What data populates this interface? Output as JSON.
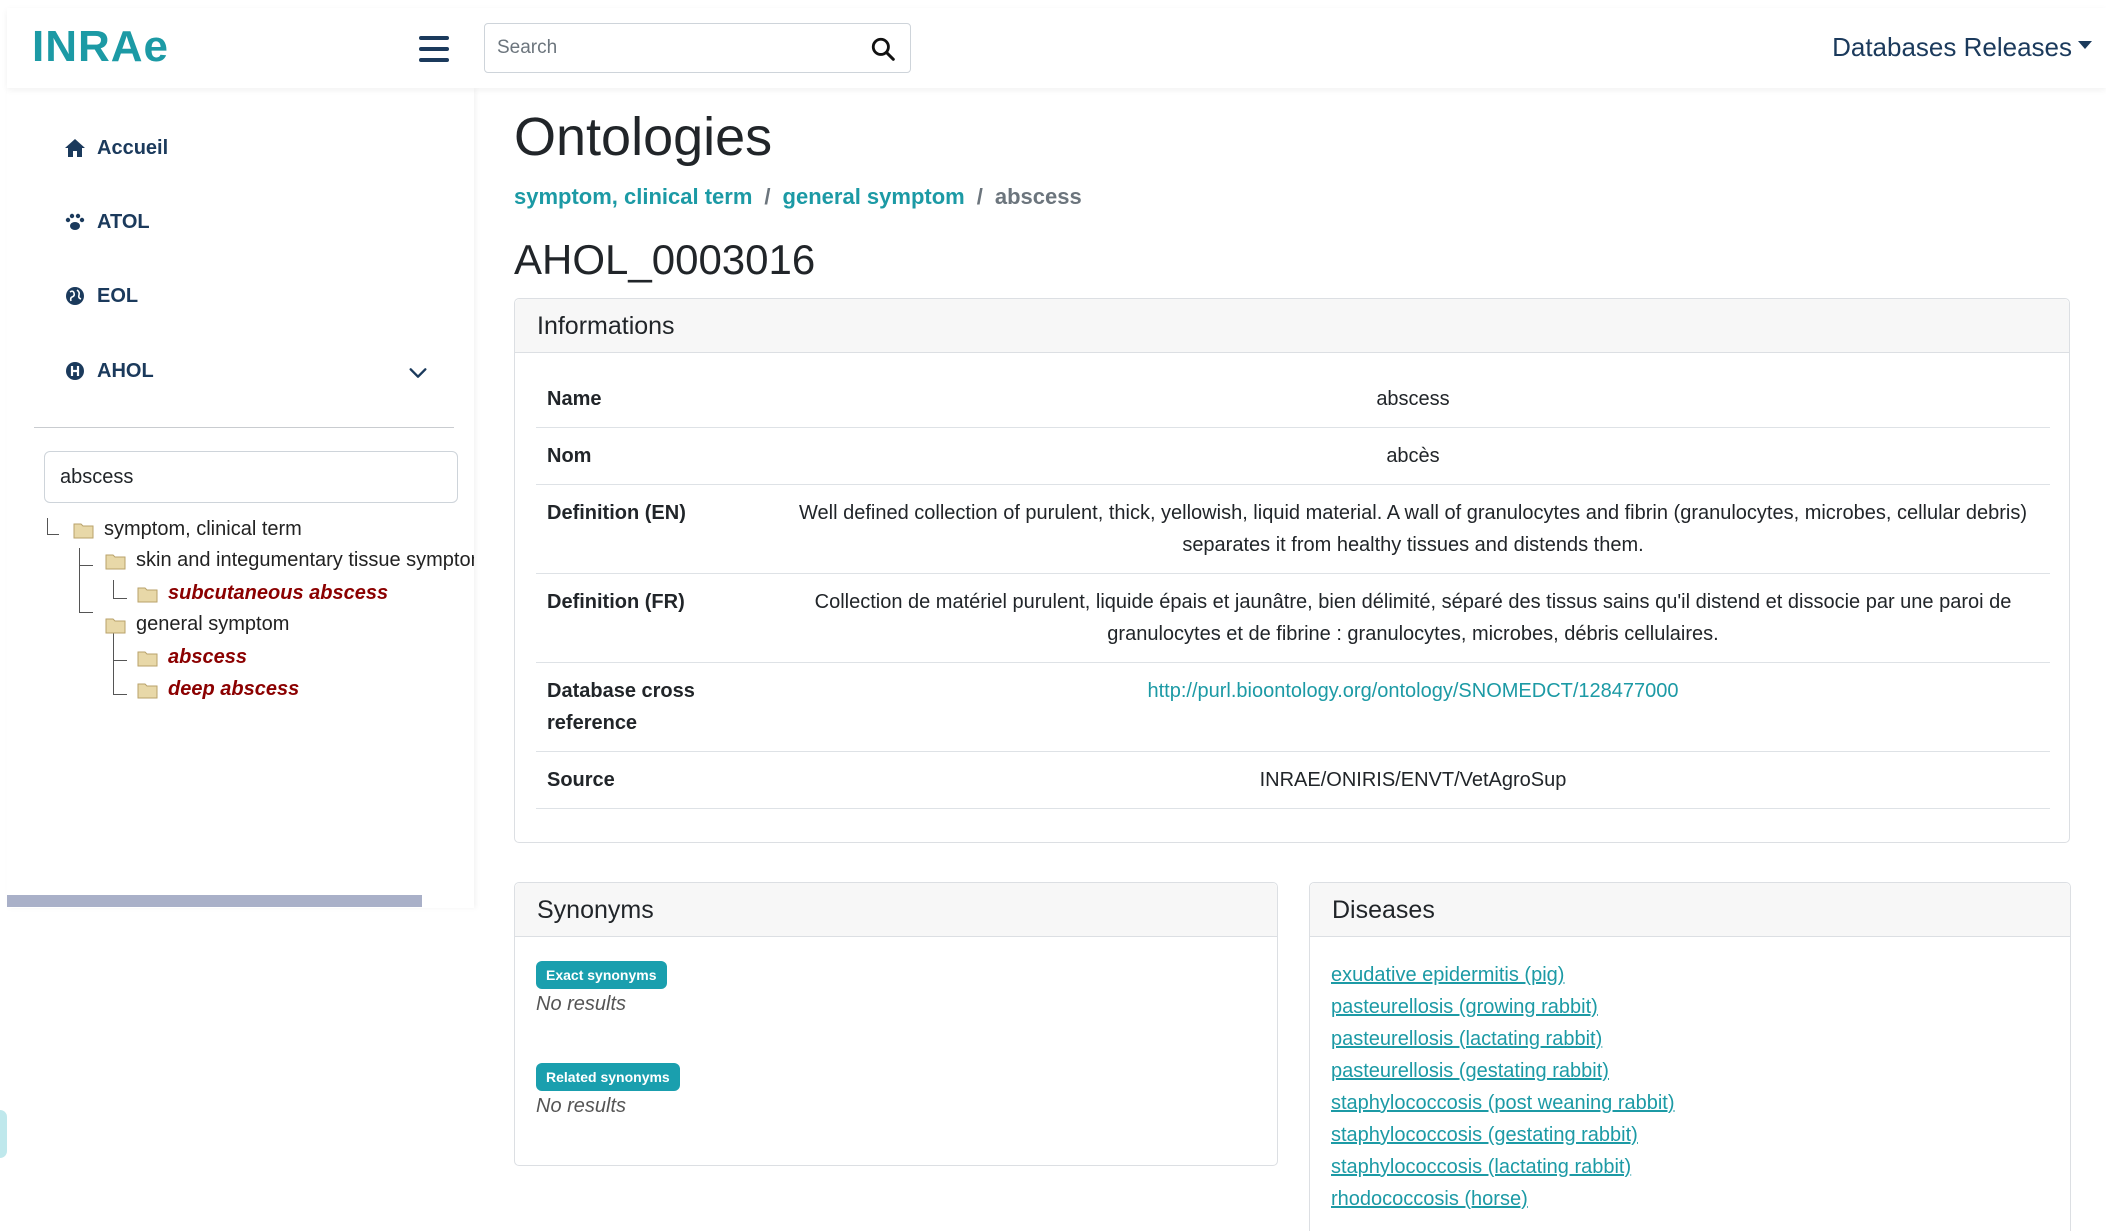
{
  "header": {
    "logo_text": "INRAe",
    "search_placeholder": "Search",
    "databases_releases_label": "Databases Releases"
  },
  "sidebar": {
    "nav": [
      {
        "label": "Accueil",
        "icon": "home-icon"
      },
      {
        "label": "ATOL",
        "icon": "paw-icon"
      },
      {
        "label": "EOL",
        "icon": "globe-icon"
      },
      {
        "label": "AHOL",
        "icon": "h-circle-icon"
      }
    ],
    "tree_search_value": "abscess",
    "tree": [
      {
        "label": "symptom, clinical term",
        "match": false
      },
      {
        "label": "skin and integumentary tissue symptom",
        "match": false
      },
      {
        "label": "subcutaneous abscess",
        "match": true
      },
      {
        "label": "general symptom",
        "match": false
      },
      {
        "label": "abscess",
        "match": true
      },
      {
        "label": "deep abscess",
        "match": true
      }
    ]
  },
  "main": {
    "title": "Ontologies",
    "breadcrumb": [
      {
        "label": "symptom, clinical term"
      },
      {
        "label": "general symptom"
      },
      {
        "label": "abscess"
      }
    ],
    "breadcrumb_separator": "/",
    "term_id": "AHOL_0003016",
    "informations": {
      "header": "Informations",
      "rows": [
        {
          "key": "Name",
          "value": "abscess"
        },
        {
          "key": "Nom",
          "value": "abcès"
        },
        {
          "key": "Definition (EN)",
          "value": "Well defined collection of purulent, thick, yellowish, liquid material. A wall of granulocytes and fibrin (granulocytes, microbes, cellular debris) separates it from healthy tissues and distends them."
        },
        {
          "key": "Definition (FR)",
          "value": "Collection de matériel purulent, liquide épais et jaunâtre, bien délimité, séparé des tissus sains qu'il distend et dissocie par une paroi de granulocytes et de fibrine : granulocytes, microbes, débris cellulaires."
        },
        {
          "key": "Database cross reference",
          "value": "http://purl.bioontology.org/ontology/SNOMEDCT/128477000",
          "link": true
        },
        {
          "key": "Source",
          "value": "INRAE/ONIRIS/ENVT/VetAgroSup"
        }
      ]
    },
    "synonyms": {
      "header": "Synonyms",
      "exact_label": "Exact synonyms",
      "exact_value": "No results",
      "related_label": "Related synonyms",
      "related_value": "No results"
    },
    "diseases": {
      "header": "Diseases",
      "items": [
        "exudative epidermitis (pig)",
        "pasteurellosis (growing rabbit)",
        "pasteurellosis (lactating rabbit)",
        "pasteurellosis (gestating rabbit)",
        "staphylococcosis (post weaning rabbit)",
        "staphylococcosis (gestating rabbit)",
        "staphylococcosis (lactating rabbit)",
        "rhodococcosis (horse)"
      ]
    }
  },
  "colors": {
    "brand_teal": "#1c9aa5",
    "nav_blue": "#1b3a5c",
    "match_red": "#8b0000"
  }
}
